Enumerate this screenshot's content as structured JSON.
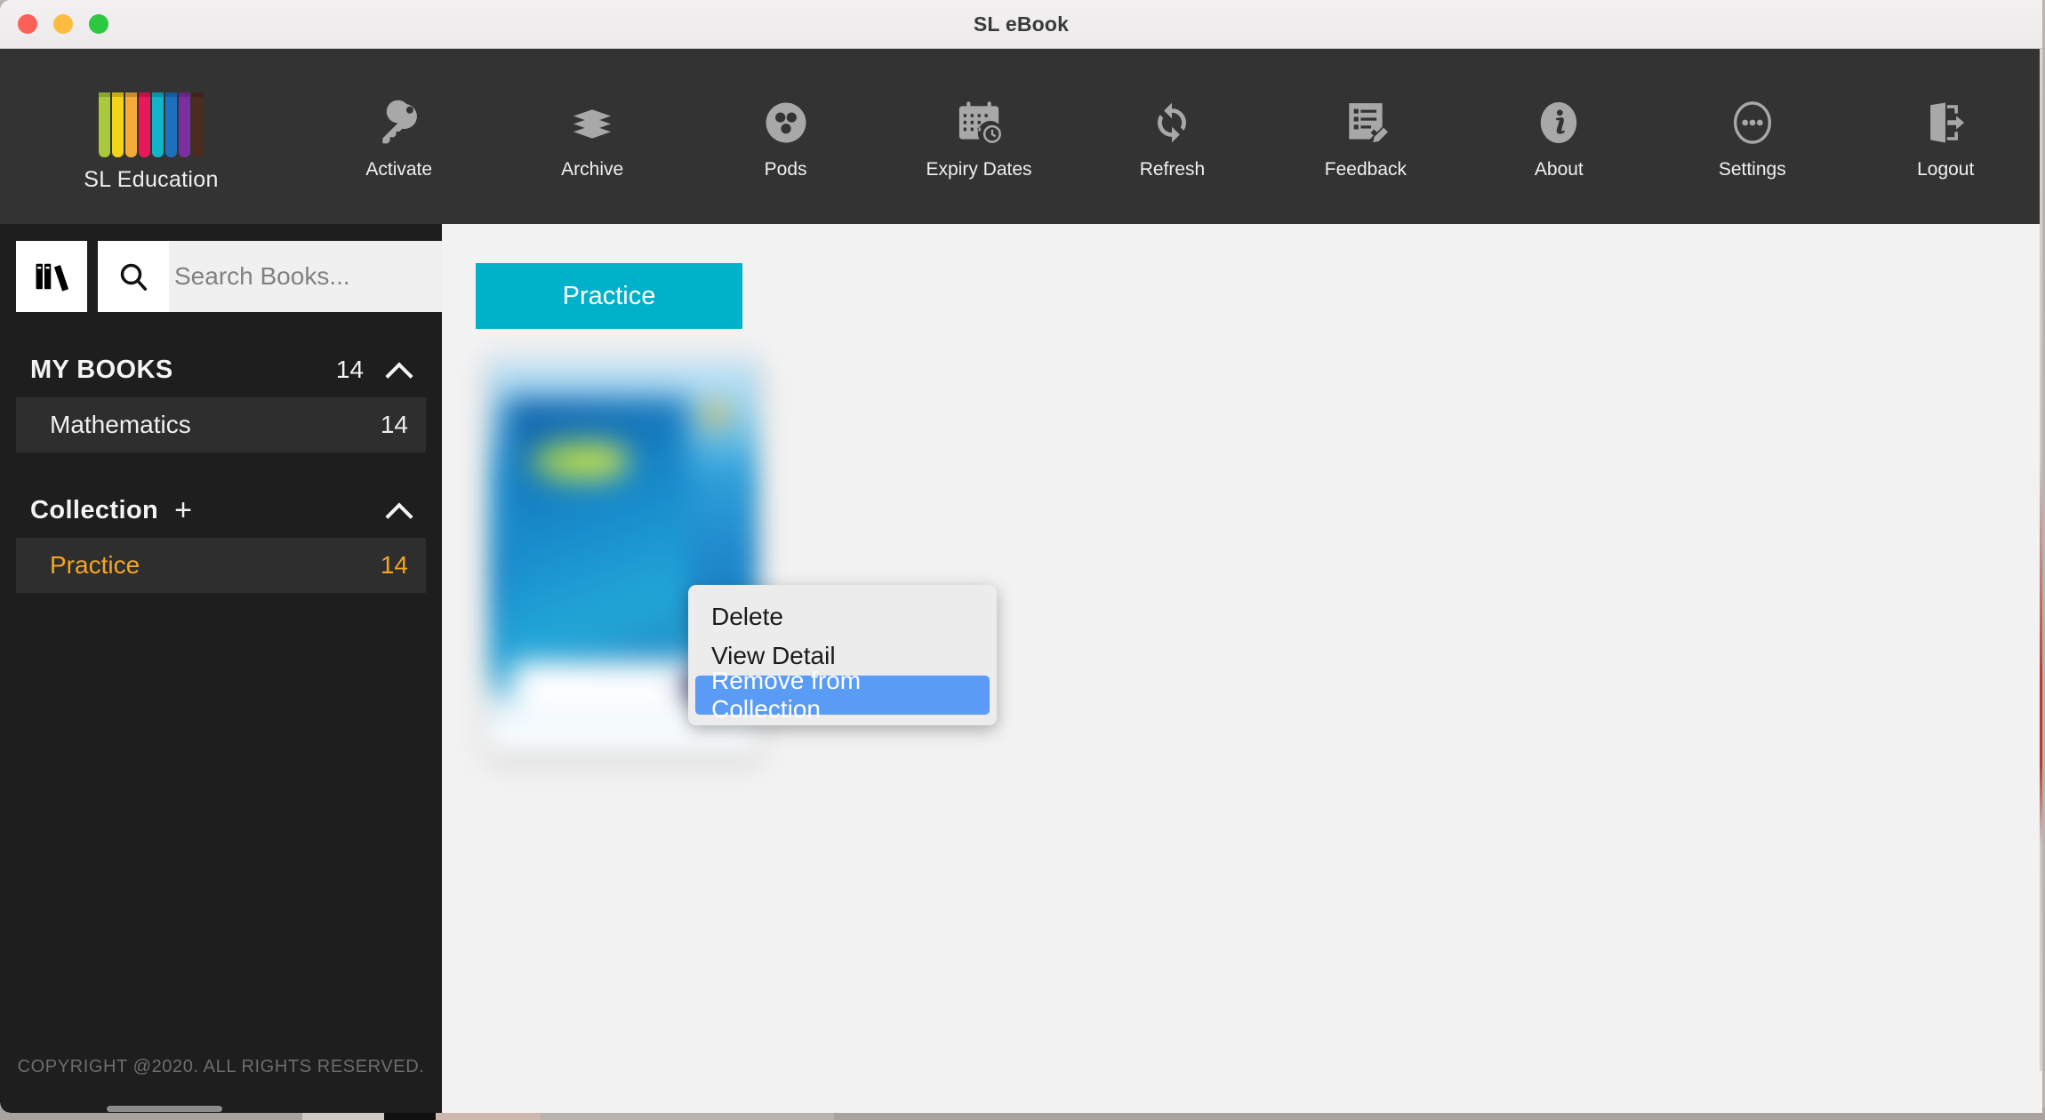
{
  "window": {
    "title": "SL eBook",
    "controls": [
      "close",
      "minimize",
      "zoom"
    ]
  },
  "brand": {
    "name": "SL Education",
    "bar_colors": [
      "#a8c93a",
      "#f2d319",
      "#f5ab3c",
      "#e8185b",
      "#13b4c8",
      "#1d70bd",
      "#7a2f9e",
      "#4a2c20"
    ]
  },
  "toolbar": {
    "items": [
      {
        "label": "Activate",
        "icon": "key-icon"
      },
      {
        "label": "Archive",
        "icon": "book-stack-icon"
      },
      {
        "label": "Pods",
        "icon": "pods-circle-icon"
      },
      {
        "label": "Expiry Dates",
        "icon": "calendar-clock-icon"
      },
      {
        "label": "Refresh",
        "icon": "refresh-icon"
      },
      {
        "label": "Feedback",
        "icon": "form-pencil-icon"
      },
      {
        "label": "About",
        "icon": "info-icon"
      },
      {
        "label": "Settings",
        "icon": "ellipsis-circle-icon"
      },
      {
        "label": "Logout",
        "icon": "logout-door-icon"
      }
    ]
  },
  "sidebar": {
    "library_button_icon": "library-books-icon",
    "search": {
      "icon": "search-icon",
      "value": "",
      "placeholder": "Search Books..."
    },
    "groups": [
      {
        "title": "MY BOOKS",
        "count": "14",
        "expanded_icon": "chevron-up-icon",
        "has_add": false,
        "items": [
          {
            "label": "Mathematics",
            "count": "14",
            "active": false
          }
        ]
      },
      {
        "title": "Collection",
        "count": "",
        "expanded_icon": "chevron-up-icon",
        "has_add": true,
        "add_icon": "plus-icon",
        "items": [
          {
            "label": "Practice",
            "count": "14",
            "active": true
          }
        ]
      }
    ],
    "copyright": "COPYRIGHT @2020. ALL RIGHTS RESERVED."
  },
  "content": {
    "collection_tab": "Practice",
    "book": {
      "cover_alt": "book-cover-thumbnail"
    }
  },
  "context_menu": {
    "items": [
      {
        "label": "Delete",
        "selected": false
      },
      {
        "label": "View Detail",
        "selected": false
      },
      {
        "label": "Remove from Collection",
        "selected": true
      }
    ]
  },
  "colors": {
    "toolbar_bg": "#333333",
    "sidebar_bg": "#1e1e1e",
    "content_bg": "#f2f2f2",
    "accent_tab": "#00b2c9",
    "active_item": "#f5a623",
    "menu_highlight": "#5a9bf5"
  }
}
